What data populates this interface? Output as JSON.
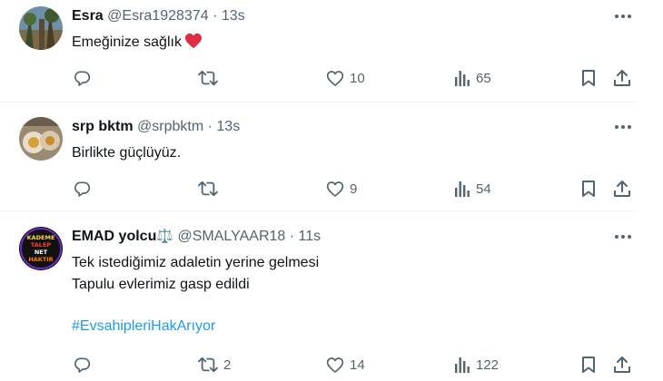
{
  "tweets": [
    {
      "name": "Esra",
      "handle": "@Esra1928374",
      "separator": "·",
      "time": "13s",
      "lines": [
        "Emeğinize sağlık"
      ],
      "emoji": "heart-emoji",
      "stats": {
        "reply": "",
        "retweet": "",
        "like": "10",
        "views": "65"
      }
    },
    {
      "name": "srp bktm",
      "handle": "@srpbktm",
      "separator": "·",
      "time": "13s",
      "lines": [
        "Birlikte güçlüyüz."
      ],
      "stats": {
        "reply": "",
        "retweet": "",
        "like": "9",
        "views": "54"
      }
    },
    {
      "name": "EMAD yolcu",
      "name_emoji": "⚖️",
      "handle": "@SMALYAAR18",
      "separator": "·",
      "time": "11s",
      "lines": [
        "Tek istediğimiz adaletin yerine gelmesi",
        "Tapulu evlerimiz gasp edildi"
      ],
      "hashtag": "#EvsahipleriHakArıyor",
      "avatar_text": [
        "KADEME",
        "TALEP",
        "NET",
        "HAKTIR"
      ],
      "stats": {
        "reply": "",
        "retweet": "2",
        "like": "14",
        "views": "122"
      }
    }
  ],
  "colors": {
    "text": "#0f1419",
    "secondary": "#536471",
    "link": "#1d9bf0",
    "heart": "#e0245e",
    "divider": "#eff3f4"
  },
  "icons": [
    "reply-icon",
    "retweet-icon",
    "like-icon",
    "views-icon",
    "bookmark-icon",
    "share-icon",
    "more-icon"
  ]
}
